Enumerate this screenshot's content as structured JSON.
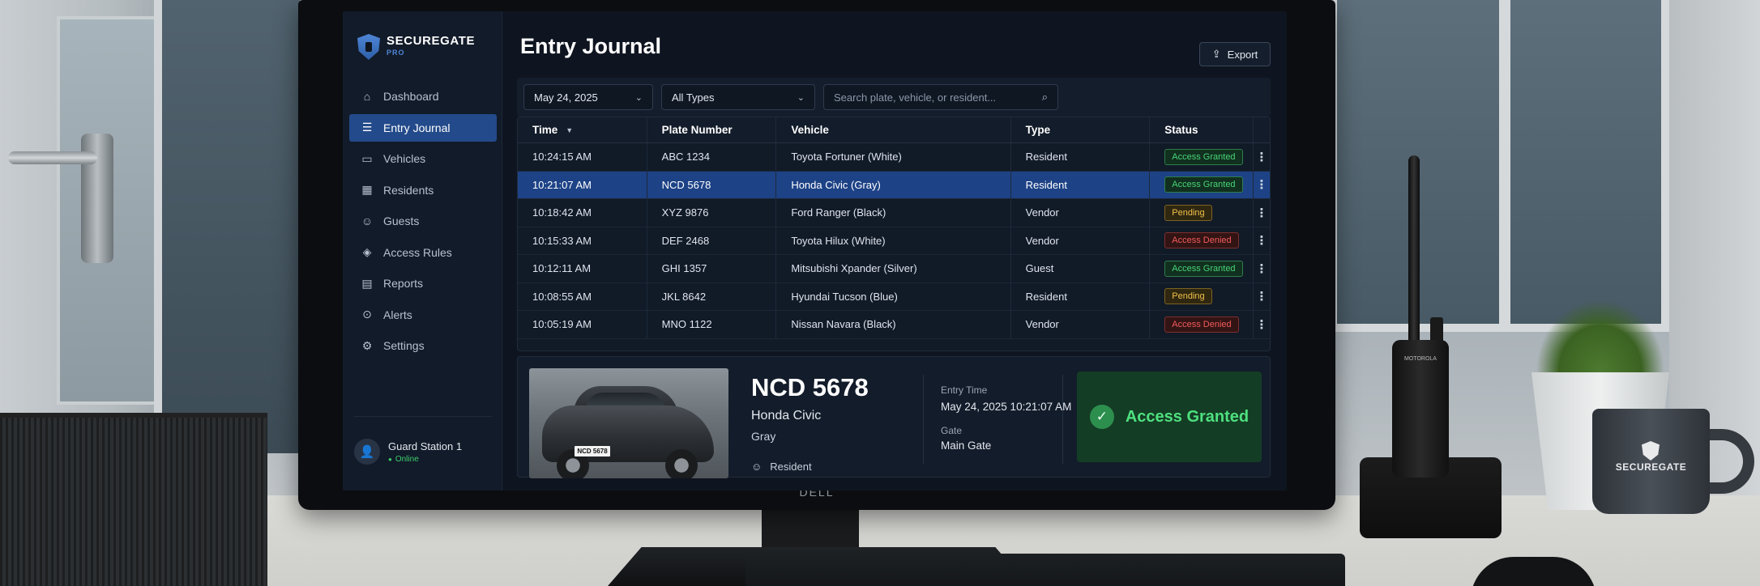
{
  "app": {
    "brand": "SECUREGATE",
    "brand_sub": "PRO",
    "page_title": "Entry Journal",
    "export_label": "Export"
  },
  "sidebar": {
    "items": [
      {
        "label": "Dashboard",
        "icon": "home-icon",
        "active": false
      },
      {
        "label": "Entry Journal",
        "icon": "journal-icon",
        "active": true
      },
      {
        "label": "Vehicles",
        "icon": "car-icon",
        "active": false
      },
      {
        "label": "Residents",
        "icon": "residents-icon",
        "active": false
      },
      {
        "label": "Guests",
        "icon": "guests-icon",
        "active": false
      },
      {
        "label": "Access Rules",
        "icon": "access-rules-icon",
        "active": false
      },
      {
        "label": "Reports",
        "icon": "reports-icon",
        "active": false
      },
      {
        "label": "Alerts",
        "icon": "alert-icon",
        "active": false
      },
      {
        "label": "Settings",
        "icon": "gear-icon",
        "active": false
      }
    ],
    "guard": {
      "name": "Guard Station 1",
      "status": "Online"
    }
  },
  "filters": {
    "date": "May 24, 2025",
    "type": "All Types",
    "search_placeholder": "Search plate, vehicle, or resident..."
  },
  "table": {
    "headers": {
      "time": "Time",
      "plate": "Plate Number",
      "vehicle": "Vehicle",
      "type": "Type",
      "status": "Status"
    },
    "rows": [
      {
        "time": "10:24:15 AM",
        "plate": "ABC 1234",
        "vehicle": "Toyota Fortuner (White)",
        "type": "Resident",
        "status": "Access Granted",
        "status_kind": "granted",
        "selected": false
      },
      {
        "time": "10:21:07 AM",
        "plate": "NCD 5678",
        "vehicle": "Honda Civic (Gray)",
        "type": "Resident",
        "status": "Access Granted",
        "status_kind": "granted",
        "selected": true
      },
      {
        "time": "10:18:42 AM",
        "plate": "XYZ 9876",
        "vehicle": "Ford Ranger (Black)",
        "type": "Vendor",
        "status": "Pending",
        "status_kind": "pending",
        "selected": false
      },
      {
        "time": "10:15:33 AM",
        "plate": "DEF 2468",
        "vehicle": "Toyota Hilux (White)",
        "type": "Vendor",
        "status": "Access Denied",
        "status_kind": "denied",
        "selected": false
      },
      {
        "time": "10:12:11 AM",
        "plate": "GHI 1357",
        "vehicle": "Mitsubishi Xpander (Silver)",
        "type": "Guest",
        "status": "Access Granted",
        "status_kind": "granted",
        "selected": false
      },
      {
        "time": "10:08:55 AM",
        "plate": "JKL 8642",
        "vehicle": "Hyundai Tucson (Blue)",
        "type": "Resident",
        "status": "Pending",
        "status_kind": "pending",
        "selected": false
      },
      {
        "time": "10:05:19 AM",
        "plate": "MNO 1122",
        "vehicle": "Nissan Navara (Black)",
        "type": "Vendor",
        "status": "Access Denied",
        "status_kind": "denied",
        "selected": false
      }
    ]
  },
  "detail": {
    "plate": "NCD 5678",
    "photo_plate": "NCD 5678",
    "model": "Honda Civic",
    "color": "Gray",
    "type": "Resident",
    "entry_time_label": "Entry Time",
    "entry_time": "May 24, 2025 10:21:07 AM",
    "gate_label": "Gate",
    "gate": "Main Gate",
    "status": "Access Granted"
  },
  "hardware": {
    "monitor_brand": "DELL",
    "mug_text": "SECUREGATE",
    "radio_text": "MOTOROLA"
  },
  "colors": {
    "accent": "#234a8a",
    "selected_row": "#1d4286",
    "granted": "#48d478",
    "pending": "#f1c24a",
    "denied": "#f25b5b"
  }
}
